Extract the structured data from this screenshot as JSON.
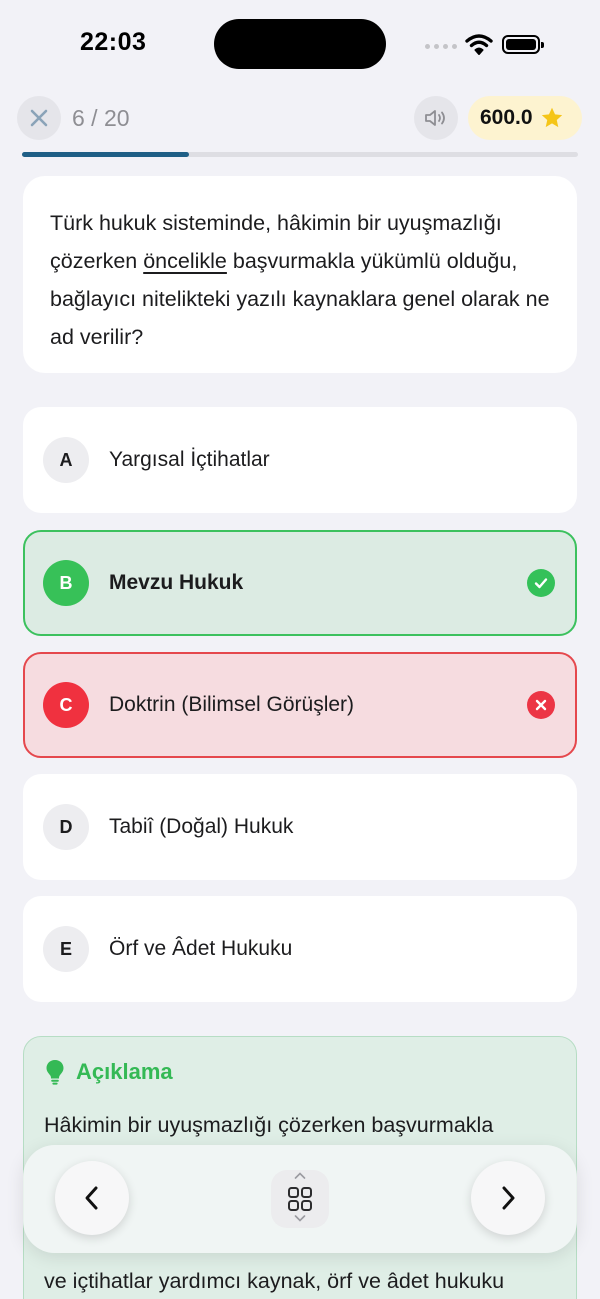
{
  "status_bar": {
    "time": "22:03",
    "icons": [
      "cellular-dots-icon",
      "wifi-icon",
      "battery-icon"
    ]
  },
  "header": {
    "close_icon": "close-icon",
    "progress_label": "6 / 20",
    "progress_fraction": 0.3,
    "sound_icon": "speaker-icon",
    "score": "600.0",
    "score_icon": "star-icon",
    "colors": {
      "progress": "#1f5f86",
      "star": "#f5c518"
    }
  },
  "question": {
    "text_before": "Türk hukuk sisteminde, hâkimin bir uyuşmazlığı çözerken ",
    "emphasis": "öncelikle",
    "text_after": " başvurmakla yükümlü olduğu, bağlayıcı nitelikteki yazılı kaynaklara genel olarak ne ad verilir?"
  },
  "options": [
    {
      "letter": "A",
      "text": "Yargısal İçtihatlar",
      "state": "neutral"
    },
    {
      "letter": "B",
      "text": "Mevzu Hukuk",
      "state": "correct"
    },
    {
      "letter": "C",
      "text": "Doktrin (Bilimsel Görüşler)",
      "state": "wrong"
    },
    {
      "letter": "D",
      "text": "Tabiî (Doğal) Hukuk",
      "state": "neutral"
    },
    {
      "letter": "E",
      "text": "Örf ve Âdet Hukuku",
      "state": "neutral"
    }
  ],
  "explanation": {
    "title": "Açıklama",
    "icon": "lightbulb-icon",
    "line1": "Hâkimin bir uyuşmazlığı çözerken başvurmakla",
    "line_last": "ve içtihatlar yardımcı kaynak, örf ve âdet hukuku"
  },
  "bottom_nav": {
    "prev_icon": "chevron-left-icon",
    "grid_icon": "grid-icon",
    "next_icon": "chevron-right-icon"
  },
  "colors": {
    "correct": "#34c159",
    "wrong": "#ec3545",
    "explain_accent": "#34b955"
  }
}
